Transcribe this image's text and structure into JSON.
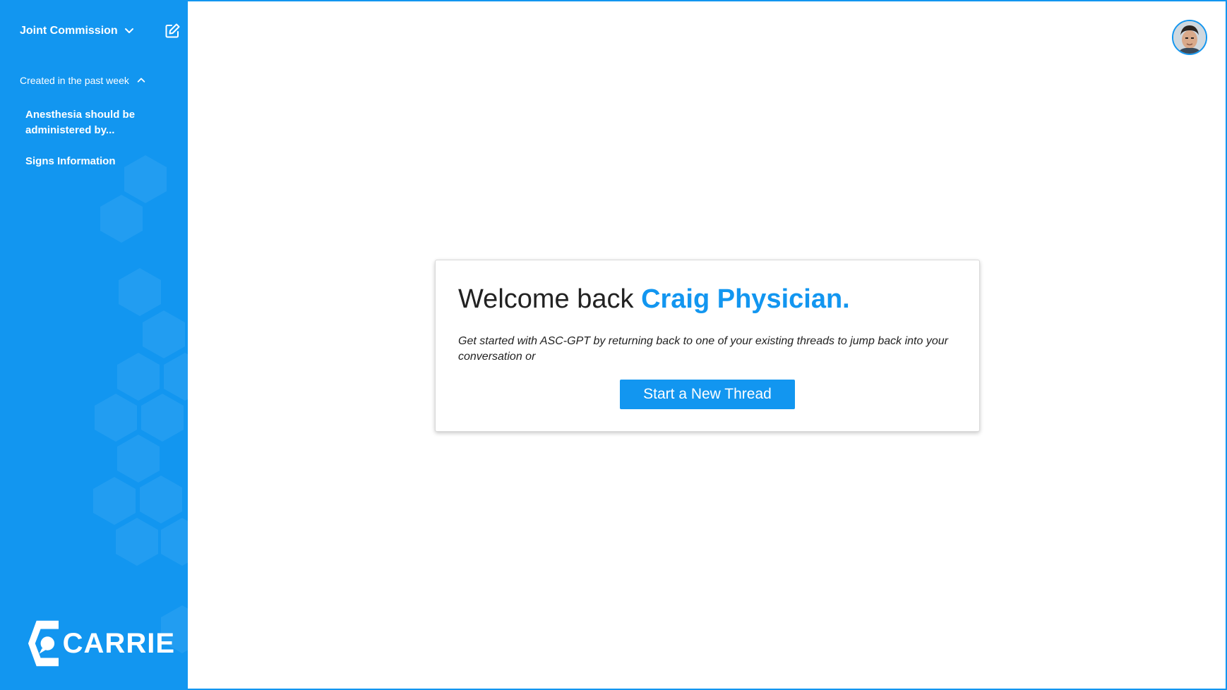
{
  "sidebar": {
    "workspace": {
      "name": "Joint Commission",
      "dropdown_icon": "chevron-down-icon",
      "edit_icon": "edit-note-icon"
    },
    "section": {
      "label": "Created in the past week",
      "toggle_icon": "chevron-up-icon",
      "threads": [
        {
          "title": "Anesthesia should be administered by..."
        },
        {
          "title": "Signs Information"
        }
      ]
    },
    "logo": {
      "text": "CARRIE",
      "icon": "carrie-logo-icon"
    }
  },
  "header": {
    "avatar_icon": "user-avatar"
  },
  "main": {
    "welcome_prefix": "Welcome back ",
    "user_name": "Craig Physician.",
    "description": "Get started with ASC-GPT by returning back to one of your existing threads to jump back into your conversation or",
    "cta_label": "Start a New Thread"
  },
  "colors": {
    "accent": "#1296f0",
    "text": "#222222",
    "background": "#ffffff"
  }
}
